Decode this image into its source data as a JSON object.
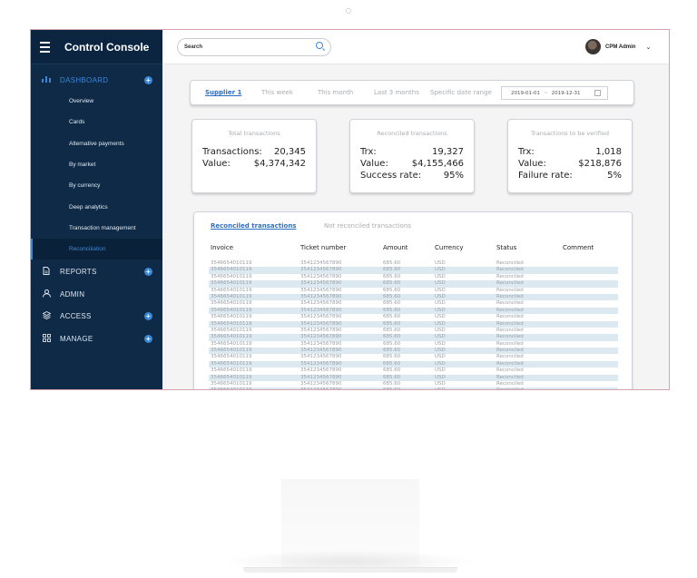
{
  "app": {
    "title": "Control Console"
  },
  "sidebar": {
    "dashboard": {
      "label": "DASHBOARD",
      "items": [
        {
          "label": "Overview"
        },
        {
          "label": "Cards"
        },
        {
          "label": "Alternative payments"
        },
        {
          "label": "By market"
        },
        {
          "label": "By currency"
        },
        {
          "label": "Deep analytics"
        },
        {
          "label": "Transaction management"
        },
        {
          "label": "Reconciliation"
        }
      ]
    },
    "sections": [
      {
        "label": "REPORTS",
        "icon": "document-icon",
        "expandable": true
      },
      {
        "label": "ADMIN",
        "icon": "person-icon",
        "expandable": false
      },
      {
        "label": "ACCESS",
        "icon": "layers-icon",
        "expandable": true
      },
      {
        "label": "MANAGE",
        "icon": "grid-icon",
        "expandable": true
      }
    ],
    "active_item": "Reconciliation"
  },
  "topbar": {
    "search_label": "Search",
    "user_name": "CPM Admin"
  },
  "filters": {
    "tabs": [
      {
        "label": "Supplier 1",
        "active": true
      },
      {
        "label": "This week",
        "active": false
      },
      {
        "label": "This month",
        "active": false
      },
      {
        "label": "Last 3 months",
        "active": false
      },
      {
        "label": "Specific date range",
        "active": false
      }
    ],
    "date_from": "2019-01-01",
    "date_sep": "~",
    "date_to": "2019-12-31"
  },
  "cards": {
    "total": {
      "title": "Total transactions",
      "transactions_label": "Transactions:",
      "transactions_value": "20,345",
      "value_label": "Value:",
      "value_value": "$4,374,342"
    },
    "reconciled": {
      "title": "Reconciled transactions",
      "trx_label": "Trx:",
      "trx_value": "19,327",
      "value_label": "Value:",
      "value_value": "$4,155,466",
      "rate_label": "Success rate:",
      "rate_value": "95%"
    },
    "to_verify": {
      "title": "Transactions to be verified",
      "trx_label": "Trx:",
      "trx_value": "1,018",
      "value_label": "Value:",
      "value_value": "$218,876",
      "rate_label": "Failure rate:",
      "rate_value": "5%"
    }
  },
  "table": {
    "tabs": [
      {
        "label": "Reconciled transactions",
        "active": true
      },
      {
        "label": "Not reconciled transactions",
        "active": false
      }
    ],
    "columns": [
      "Invoice",
      "Ticket number",
      "Amount",
      "Currency",
      "Status",
      "Comment"
    ],
    "rows": [
      [
        "3546654010119",
        "3541234567890",
        "685.60",
        "USD",
        "Reconciled",
        ""
      ],
      [
        "3546654010119",
        "3541234567890",
        "685.60",
        "USD",
        "Reconciled",
        ""
      ],
      [
        "3546654010119",
        "3541234567890",
        "685.60",
        "USD",
        "Reconciled",
        ""
      ],
      [
        "3546654010119",
        "3541234567890",
        "685.60",
        "USD",
        "Reconciled",
        ""
      ],
      [
        "3546654010119",
        "3541234567890",
        "685.60",
        "USD",
        "Reconciled",
        ""
      ],
      [
        "3546654010119",
        "3541234567890",
        "685.60",
        "USD",
        "Reconciled",
        ""
      ],
      [
        "3546654010119",
        "3541234567890",
        "685.60",
        "USD",
        "Reconciled",
        ""
      ],
      [
        "3546654010119",
        "3541234567890",
        "685.60",
        "USD",
        "Reconciled",
        ""
      ],
      [
        "3546654010119",
        "3541234567890",
        "685.60",
        "USD",
        "Reconciled",
        ""
      ],
      [
        "3546654010119",
        "3541234567890",
        "685.60",
        "USD",
        "Reconciled",
        ""
      ],
      [
        "3546654010119",
        "3541234567890",
        "685.60",
        "USD",
        "Reconciled",
        ""
      ],
      [
        "3546654010119",
        "3541234567890",
        "685.60",
        "USD",
        "Reconciled",
        ""
      ],
      [
        "3546654010119",
        "3541234567890",
        "685.60",
        "USD",
        "Reconciled",
        ""
      ],
      [
        "3546654010119",
        "3541234567890",
        "685.60",
        "USD",
        "Reconciled",
        ""
      ],
      [
        "3546654010119",
        "3541234567890",
        "685.60",
        "USD",
        "Reconciled",
        ""
      ],
      [
        "3546654010119",
        "3541234567890",
        "685.60",
        "USD",
        "Reconciled",
        ""
      ],
      [
        "3546654010119",
        "3541234567890",
        "685.60",
        "USD",
        "Reconciled",
        ""
      ],
      [
        "3546654010119",
        "3541234567890",
        "685.60",
        "USD",
        "Reconciled",
        ""
      ],
      [
        "3546654010119",
        "3541234567890",
        "685.60",
        "USD",
        "Reconciled",
        ""
      ],
      [
        "3546654010119",
        "3541234567890",
        "685.60",
        "USD",
        "Reconciled",
        ""
      ]
    ]
  },
  "colors": {
    "sidebar_bg": "#0e2a47",
    "accent": "#3d86d6",
    "row_alt": "#dde9f1"
  }
}
